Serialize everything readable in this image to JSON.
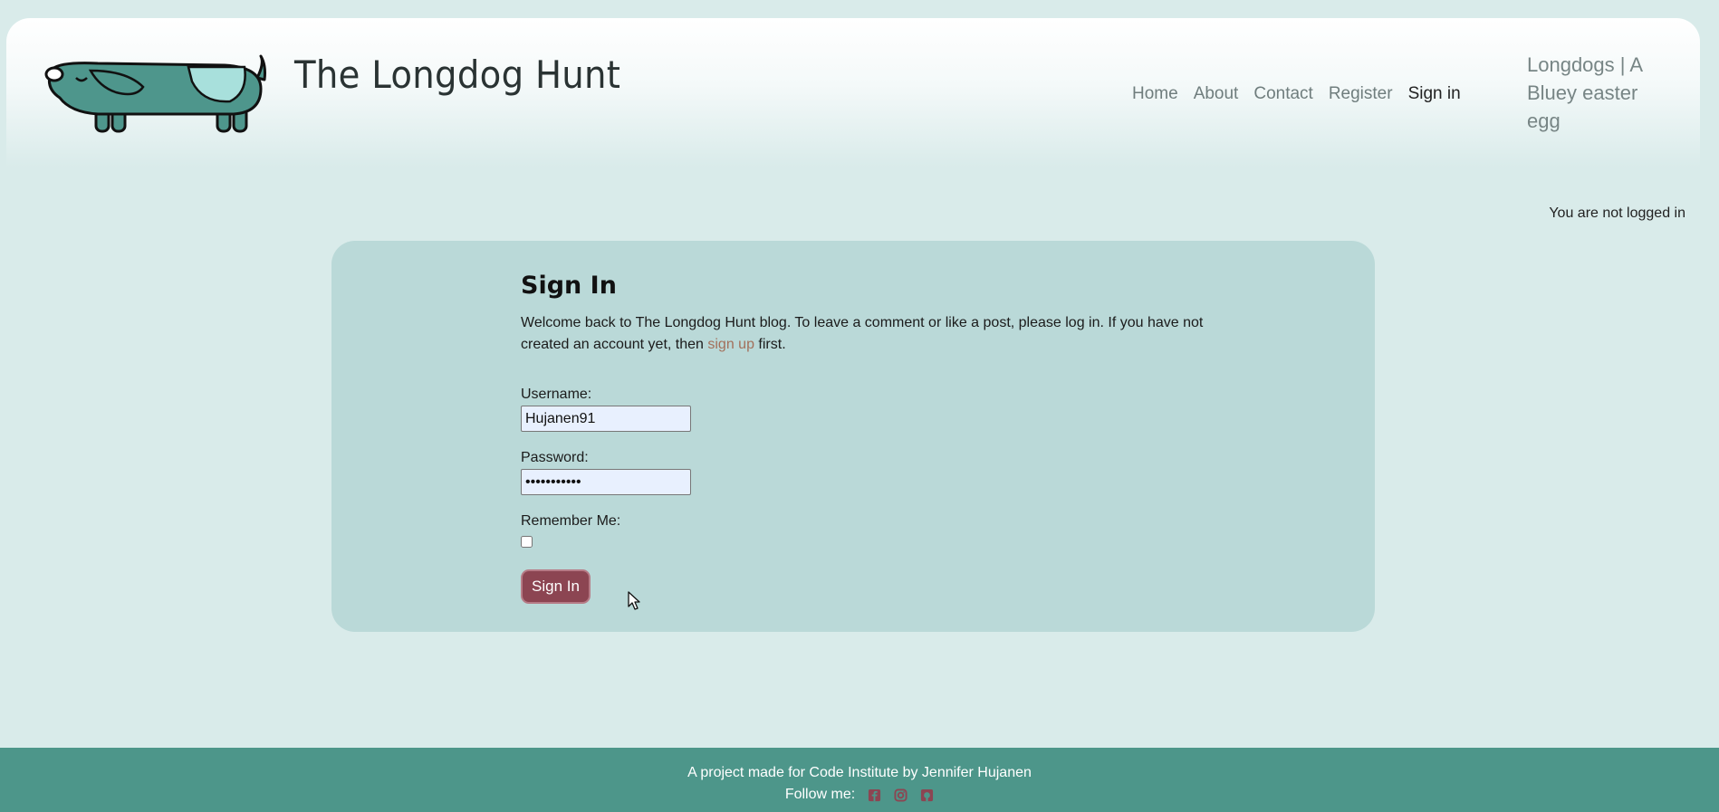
{
  "header": {
    "site_title": "The Longdog Hunt",
    "nav": [
      {
        "label": "Home",
        "active": false
      },
      {
        "label": "About",
        "active": false
      },
      {
        "label": "Contact",
        "active": false
      },
      {
        "label": "Register",
        "active": false
      },
      {
        "label": "Sign in",
        "active": true
      }
    ],
    "easter_egg_link": "Longdogs | A Bluey easter egg"
  },
  "auth_status": "You are not logged in",
  "signin": {
    "title": "Sign In",
    "intro_before": "Welcome back to The Longdog Hunt blog. To leave a comment or like a post, please log in. If you have not created an account yet, then",
    "intro_link": "sign up",
    "intro_after": "first.",
    "username_label": "Username:",
    "username_value": "Hujanen91",
    "password_label": "Password:",
    "password_value": "•••••••••••",
    "remember_label": "Remember Me:",
    "remember_checked": false,
    "submit_label": "Sign In"
  },
  "footer": {
    "credit": "A project made for Code Institute by Jennifer Hujanen",
    "follow_label": "Follow me:",
    "social_icons": [
      "facebook-icon",
      "instagram-icon",
      "github-icon"
    ]
  },
  "colors": {
    "page_bg": "#d9ebea",
    "card_bg": "#bad9d8",
    "footer_bg": "#4d968a",
    "button_bg": "#8c4552",
    "link_accent": "#a3705b",
    "social_icon": "#8c4552",
    "logo_body": "#4e968c"
  }
}
